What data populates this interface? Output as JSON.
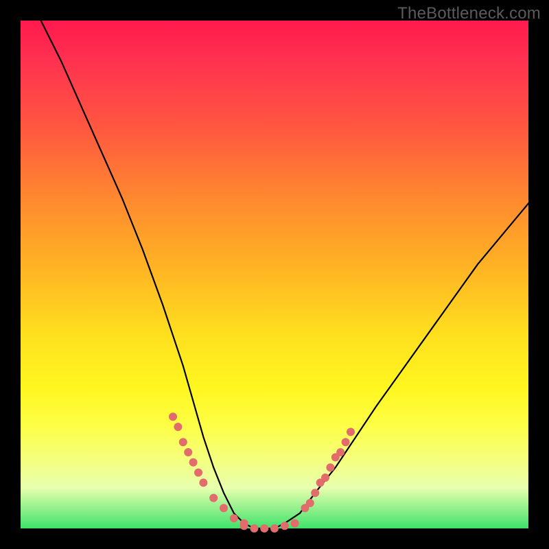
{
  "watermark": "TheBottleneck.com",
  "chart_data": {
    "type": "line",
    "title": "",
    "xlabel": "",
    "ylabel": "",
    "xlim": [
      0,
      100
    ],
    "ylim": [
      0,
      100
    ],
    "grid": false,
    "legend": false,
    "series": [
      {
        "name": "curve",
        "color": "#000000",
        "x": [
          4,
          8,
          12,
          16,
          20,
          24,
          28,
          30,
          32,
          34,
          36,
          38,
          40,
          42,
          44,
          46,
          48,
          50,
          52,
          55,
          58,
          62,
          66,
          70,
          75,
          80,
          85,
          90,
          95,
          100
        ],
        "y": [
          100,
          92,
          83,
          74,
          65,
          55,
          44,
          38,
          32,
          25,
          18,
          12,
          7,
          3,
          1,
          0,
          0,
          0,
          1,
          3,
          7,
          12,
          18,
          24,
          31,
          38,
          45,
          52,
          58,
          64
        ]
      }
    ],
    "markers": {
      "color": "#e26b6b",
      "left_cluster": [
        [
          30,
          22
        ],
        [
          31,
          20
        ],
        [
          32,
          17
        ],
        [
          33,
          15
        ],
        [
          34,
          13
        ],
        [
          35,
          11
        ],
        [
          36,
          9
        ],
        [
          38,
          6
        ],
        [
          40,
          4
        ],
        [
          42,
          2
        ],
        [
          44,
          1
        ]
      ],
      "right_cluster": [
        [
          56,
          4
        ],
        [
          57,
          5
        ],
        [
          58,
          7
        ],
        [
          59,
          9
        ],
        [
          60,
          10
        ],
        [
          61,
          12
        ],
        [
          62,
          14
        ],
        [
          63,
          15
        ],
        [
          64,
          17
        ],
        [
          65,
          19
        ]
      ],
      "bottom_cluster": [
        [
          44,
          0.5
        ],
        [
          46,
          0
        ],
        [
          48,
          0
        ],
        [
          50,
          0
        ],
        [
          52,
          0.5
        ],
        [
          54,
          1
        ]
      ]
    }
  }
}
